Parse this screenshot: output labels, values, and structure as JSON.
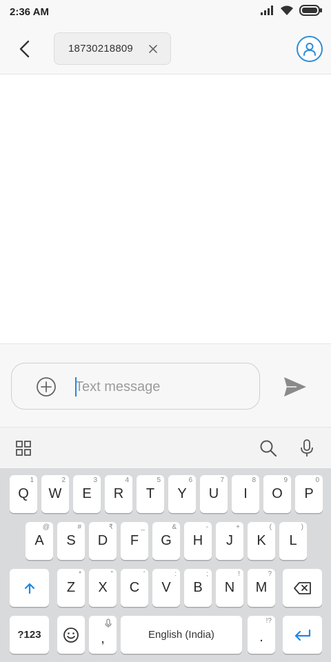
{
  "status_bar": {
    "time": "2:36 AM",
    "icons": [
      "signal-icon",
      "wifi-icon",
      "battery-icon"
    ]
  },
  "header": {
    "back_icon": "back-arrow-icon",
    "recipient": "18730218809",
    "remove_icon": "close-icon",
    "contact_icon": "person-icon"
  },
  "composer": {
    "placeholder": "Text message",
    "value": "",
    "add_icon": "plus-circle-icon",
    "send_icon": "send-icon"
  },
  "keyboard_toolbar": {
    "icons": [
      "grid-icon",
      "search-icon",
      "microphone-icon"
    ]
  },
  "keyboard": {
    "row1": [
      {
        "key": "Q",
        "hint": "1"
      },
      {
        "key": "W",
        "hint": "2"
      },
      {
        "key": "E",
        "hint": "3"
      },
      {
        "key": "R",
        "hint": "4"
      },
      {
        "key": "T",
        "hint": "5"
      },
      {
        "key": "Y",
        "hint": "6"
      },
      {
        "key": "U",
        "hint": "7"
      },
      {
        "key": "I",
        "hint": "8"
      },
      {
        "key": "O",
        "hint": "9"
      },
      {
        "key": "P",
        "hint": "0"
      }
    ],
    "row2": [
      {
        "key": "A",
        "hint": "@"
      },
      {
        "key": "S",
        "hint": "#"
      },
      {
        "key": "D",
        "hint": "₹"
      },
      {
        "key": "F",
        "hint": "_"
      },
      {
        "key": "G",
        "hint": "&"
      },
      {
        "key": "H",
        "hint": "-"
      },
      {
        "key": "J",
        "hint": "+"
      },
      {
        "key": "K",
        "hint": "("
      },
      {
        "key": "L",
        "hint": ")"
      }
    ],
    "row3": [
      {
        "key": "Z",
        "hint": "*"
      },
      {
        "key": "X",
        "hint": "\""
      },
      {
        "key": "C",
        "hint": "'"
      },
      {
        "key": "V",
        "hint": ":"
      },
      {
        "key": "B",
        "hint": ";"
      },
      {
        "key": "N",
        "hint": "!"
      },
      {
        "key": "M",
        "hint": "?"
      }
    ],
    "shift_icon": "shift-arrow-icon",
    "backspace_icon": "backspace-icon",
    "symbols_label": "?123",
    "emoji_icon": "smiley-icon",
    "comma_label": ",",
    "comma_hint_icon": "microphone-icon",
    "space_label": "English (India)",
    "period_label": ".",
    "period_hint": "!?",
    "enter_icon": "enter-arrow-icon",
    "accent_color": "#1e88e5"
  }
}
